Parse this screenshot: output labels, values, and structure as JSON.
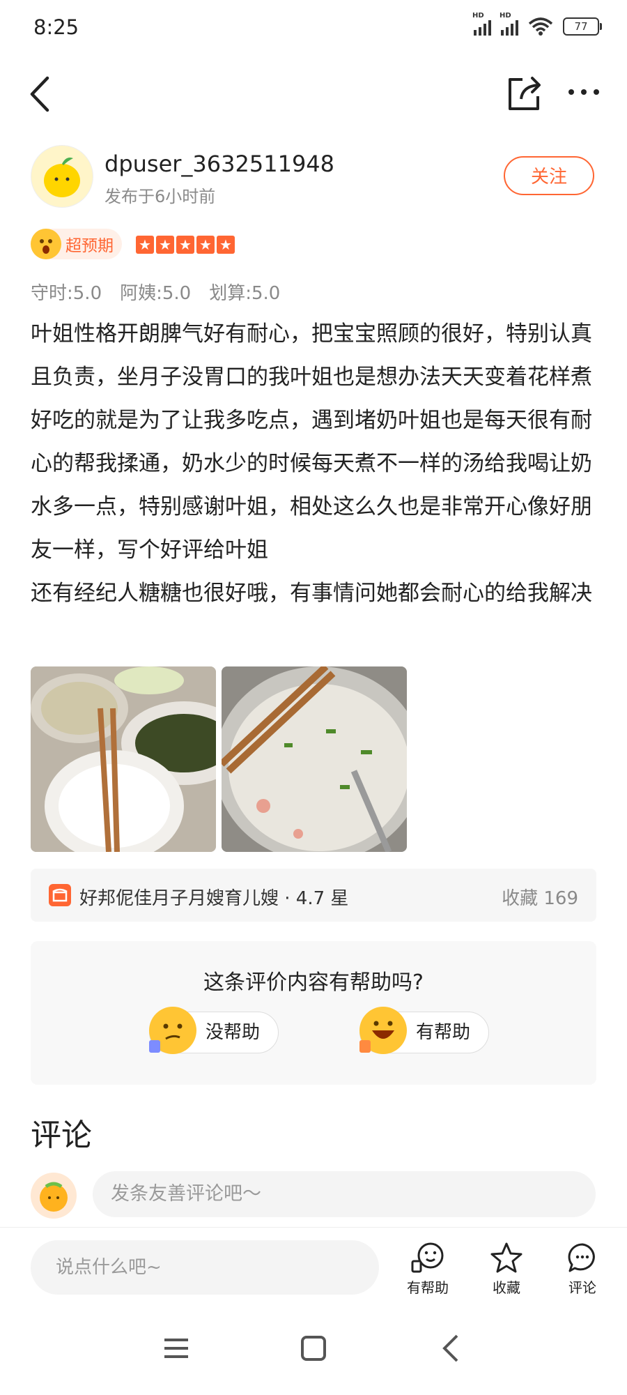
{
  "status": {
    "time": "8:25",
    "battery": "77",
    "hd1": "HD",
    "hd2": "HD"
  },
  "author": {
    "username": "dpuser_3632511948",
    "posted": "发布于6小时前",
    "follow": "关注"
  },
  "rating": {
    "badge": "超预期",
    "stars": 5,
    "scores": [
      "守时:5.0",
      "阿姨:5.0",
      "划算:5.0"
    ]
  },
  "review": {
    "text": "叶姐性格开朗脾气好有耐心，把宝宝照顾的很好，特别认真且负责，坐月子没胃口的我叶姐也是想办法天天变着花样煮好吃的就是为了让我多吃点，遇到堵奶叶姐也是每天很有耐心的帮我揉通，奶水少的时候每天煮不一样的汤给我喝让奶水多一点，特别感谢叶姐，相处这么久也是非常开心像好朋友一样，写个好评给叶姐\n还有经纪人糖糖也很好哦，有事情问她都会耐心的给我解决"
  },
  "shop": {
    "name": "好邦伲佳月子月嫂育儿嫂 · 4.7 星",
    "favorites": "收藏 169"
  },
  "helpful": {
    "question": "这条评价内容有帮助吗?",
    "no": "没帮助",
    "yes": "有帮助"
  },
  "comments": {
    "title": "评论",
    "placeholder": "发条友善评论吧～"
  },
  "bottom_bar": {
    "input_placeholder": "说点什么吧~",
    "helpful": "有帮助",
    "favorite": "收藏",
    "comment": "评论"
  },
  "colors": {
    "accent": "#ff6633",
    "text": "#222222",
    "muted": "#8a8a8a"
  }
}
